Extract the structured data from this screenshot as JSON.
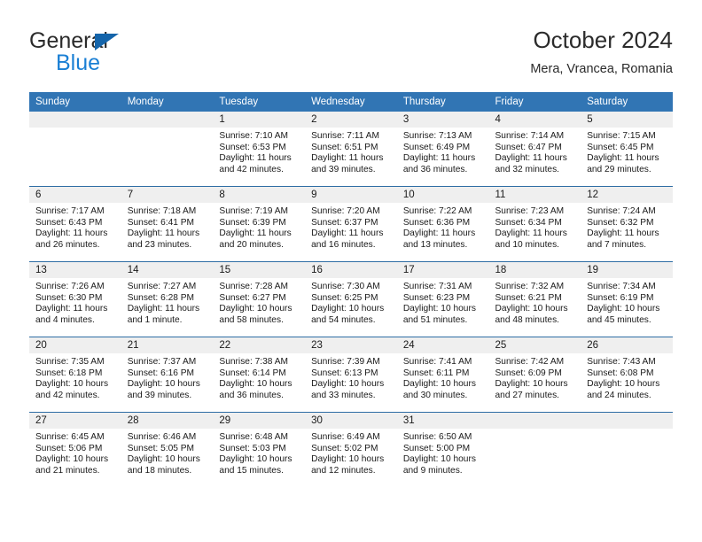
{
  "brand": {
    "name_line1": "General",
    "name_line2": "Blue",
    "logo_icon": "triangle-icon",
    "accent_color": "#1464aa",
    "blue_text_color": "#1a7fd4"
  },
  "header": {
    "title": "October 2024",
    "subtitle": "Mera, Vrancea, Romania"
  },
  "theme": {
    "header_row_background": "#3175b4",
    "row_separator": "#2e6da4",
    "date_band_background": "#efefef",
    "text_color": "#1a1a1a"
  },
  "weekday_headers": [
    "Sunday",
    "Monday",
    "Tuesday",
    "Wednesday",
    "Thursday",
    "Friday",
    "Saturday"
  ],
  "weeks": [
    [
      {
        "date": "",
        "empty": true
      },
      {
        "date": "",
        "empty": true
      },
      {
        "date": "1",
        "sunrise": "Sunrise: 7:10 AM",
        "sunset": "Sunset: 6:53 PM",
        "daylight_line1": "Daylight: 11 hours",
        "daylight_line2": "and 42 minutes."
      },
      {
        "date": "2",
        "sunrise": "Sunrise: 7:11 AM",
        "sunset": "Sunset: 6:51 PM",
        "daylight_line1": "Daylight: 11 hours",
        "daylight_line2": "and 39 minutes."
      },
      {
        "date": "3",
        "sunrise": "Sunrise: 7:13 AM",
        "sunset": "Sunset: 6:49 PM",
        "daylight_line1": "Daylight: 11 hours",
        "daylight_line2": "and 36 minutes."
      },
      {
        "date": "4",
        "sunrise": "Sunrise: 7:14 AM",
        "sunset": "Sunset: 6:47 PM",
        "daylight_line1": "Daylight: 11 hours",
        "daylight_line2": "and 32 minutes."
      },
      {
        "date": "5",
        "sunrise": "Sunrise: 7:15 AM",
        "sunset": "Sunset: 6:45 PM",
        "daylight_line1": "Daylight: 11 hours",
        "daylight_line2": "and 29 minutes."
      }
    ],
    [
      {
        "date": "6",
        "sunrise": "Sunrise: 7:17 AM",
        "sunset": "Sunset: 6:43 PM",
        "daylight_line1": "Daylight: 11 hours",
        "daylight_line2": "and 26 minutes."
      },
      {
        "date": "7",
        "sunrise": "Sunrise: 7:18 AM",
        "sunset": "Sunset: 6:41 PM",
        "daylight_line1": "Daylight: 11 hours",
        "daylight_line2": "and 23 minutes."
      },
      {
        "date": "8",
        "sunrise": "Sunrise: 7:19 AM",
        "sunset": "Sunset: 6:39 PM",
        "daylight_line1": "Daylight: 11 hours",
        "daylight_line2": "and 20 minutes."
      },
      {
        "date": "9",
        "sunrise": "Sunrise: 7:20 AM",
        "sunset": "Sunset: 6:37 PM",
        "daylight_line1": "Daylight: 11 hours",
        "daylight_line2": "and 16 minutes."
      },
      {
        "date": "10",
        "sunrise": "Sunrise: 7:22 AM",
        "sunset": "Sunset: 6:36 PM",
        "daylight_line1": "Daylight: 11 hours",
        "daylight_line2": "and 13 minutes."
      },
      {
        "date": "11",
        "sunrise": "Sunrise: 7:23 AM",
        "sunset": "Sunset: 6:34 PM",
        "daylight_line1": "Daylight: 11 hours",
        "daylight_line2": "and 10 minutes."
      },
      {
        "date": "12",
        "sunrise": "Sunrise: 7:24 AM",
        "sunset": "Sunset: 6:32 PM",
        "daylight_line1": "Daylight: 11 hours",
        "daylight_line2": "and 7 minutes."
      }
    ],
    [
      {
        "date": "13",
        "sunrise": "Sunrise: 7:26 AM",
        "sunset": "Sunset: 6:30 PM",
        "daylight_line1": "Daylight: 11 hours",
        "daylight_line2": "and 4 minutes."
      },
      {
        "date": "14",
        "sunrise": "Sunrise: 7:27 AM",
        "sunset": "Sunset: 6:28 PM",
        "daylight_line1": "Daylight: 11 hours",
        "daylight_line2": "and 1 minute."
      },
      {
        "date": "15",
        "sunrise": "Sunrise: 7:28 AM",
        "sunset": "Sunset: 6:27 PM",
        "daylight_line1": "Daylight: 10 hours",
        "daylight_line2": "and 58 minutes."
      },
      {
        "date": "16",
        "sunrise": "Sunrise: 7:30 AM",
        "sunset": "Sunset: 6:25 PM",
        "daylight_line1": "Daylight: 10 hours",
        "daylight_line2": "and 54 minutes."
      },
      {
        "date": "17",
        "sunrise": "Sunrise: 7:31 AM",
        "sunset": "Sunset: 6:23 PM",
        "daylight_line1": "Daylight: 10 hours",
        "daylight_line2": "and 51 minutes."
      },
      {
        "date": "18",
        "sunrise": "Sunrise: 7:32 AM",
        "sunset": "Sunset: 6:21 PM",
        "daylight_line1": "Daylight: 10 hours",
        "daylight_line2": "and 48 minutes."
      },
      {
        "date": "19",
        "sunrise": "Sunrise: 7:34 AM",
        "sunset": "Sunset: 6:19 PM",
        "daylight_line1": "Daylight: 10 hours",
        "daylight_line2": "and 45 minutes."
      }
    ],
    [
      {
        "date": "20",
        "sunrise": "Sunrise: 7:35 AM",
        "sunset": "Sunset: 6:18 PM",
        "daylight_line1": "Daylight: 10 hours",
        "daylight_line2": "and 42 minutes."
      },
      {
        "date": "21",
        "sunrise": "Sunrise: 7:37 AM",
        "sunset": "Sunset: 6:16 PM",
        "daylight_line1": "Daylight: 10 hours",
        "daylight_line2": "and 39 minutes."
      },
      {
        "date": "22",
        "sunrise": "Sunrise: 7:38 AM",
        "sunset": "Sunset: 6:14 PM",
        "daylight_line1": "Daylight: 10 hours",
        "daylight_line2": "and 36 minutes."
      },
      {
        "date": "23",
        "sunrise": "Sunrise: 7:39 AM",
        "sunset": "Sunset: 6:13 PM",
        "daylight_line1": "Daylight: 10 hours",
        "daylight_line2": "and 33 minutes."
      },
      {
        "date": "24",
        "sunrise": "Sunrise: 7:41 AM",
        "sunset": "Sunset: 6:11 PM",
        "daylight_line1": "Daylight: 10 hours",
        "daylight_line2": "and 30 minutes."
      },
      {
        "date": "25",
        "sunrise": "Sunrise: 7:42 AM",
        "sunset": "Sunset: 6:09 PM",
        "daylight_line1": "Daylight: 10 hours",
        "daylight_line2": "and 27 minutes."
      },
      {
        "date": "26",
        "sunrise": "Sunrise: 7:43 AM",
        "sunset": "Sunset: 6:08 PM",
        "daylight_line1": "Daylight: 10 hours",
        "daylight_line2": "and 24 minutes."
      }
    ],
    [
      {
        "date": "27",
        "sunrise": "Sunrise: 6:45 AM",
        "sunset": "Sunset: 5:06 PM",
        "daylight_line1": "Daylight: 10 hours",
        "daylight_line2": "and 21 minutes."
      },
      {
        "date": "28",
        "sunrise": "Sunrise: 6:46 AM",
        "sunset": "Sunset: 5:05 PM",
        "daylight_line1": "Daylight: 10 hours",
        "daylight_line2": "and 18 minutes."
      },
      {
        "date": "29",
        "sunrise": "Sunrise: 6:48 AM",
        "sunset": "Sunset: 5:03 PM",
        "daylight_line1": "Daylight: 10 hours",
        "daylight_line2": "and 15 minutes."
      },
      {
        "date": "30",
        "sunrise": "Sunrise: 6:49 AM",
        "sunset": "Sunset: 5:02 PM",
        "daylight_line1": "Daylight: 10 hours",
        "daylight_line2": "and 12 minutes."
      },
      {
        "date": "31",
        "sunrise": "Sunrise: 6:50 AM",
        "sunset": "Sunset: 5:00 PM",
        "daylight_line1": "Daylight: 10 hours",
        "daylight_line2": "and 9 minutes."
      },
      {
        "date": "",
        "empty": true
      },
      {
        "date": "",
        "empty": true
      }
    ]
  ]
}
